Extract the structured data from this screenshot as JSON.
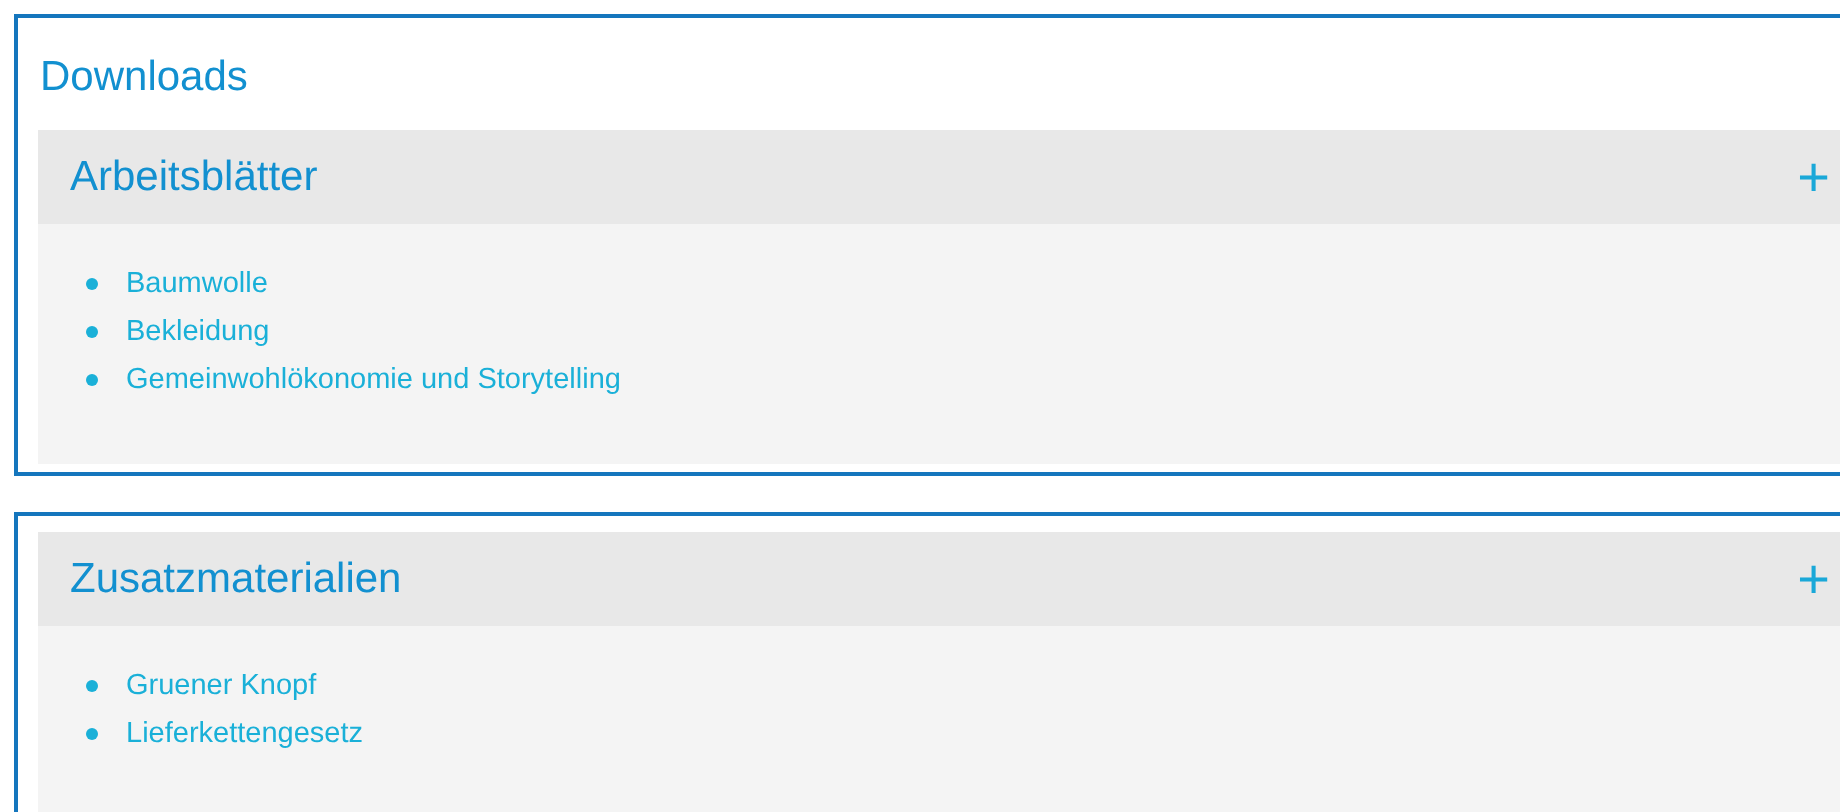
{
  "sections": [
    {
      "title": "Downloads",
      "accordion": {
        "title": "Arbeitsblätter",
        "toggle": "+",
        "items": [
          "Baumwolle",
          "Bekleidung",
          "Gemeinwohlökonomie und Storytelling"
        ]
      }
    },
    {
      "accordion": {
        "title": "Zusatzmaterialien",
        "toggle": "+",
        "items": [
          "Gruener Knopf",
          "Lieferkettengesetz"
        ]
      }
    }
  ]
}
